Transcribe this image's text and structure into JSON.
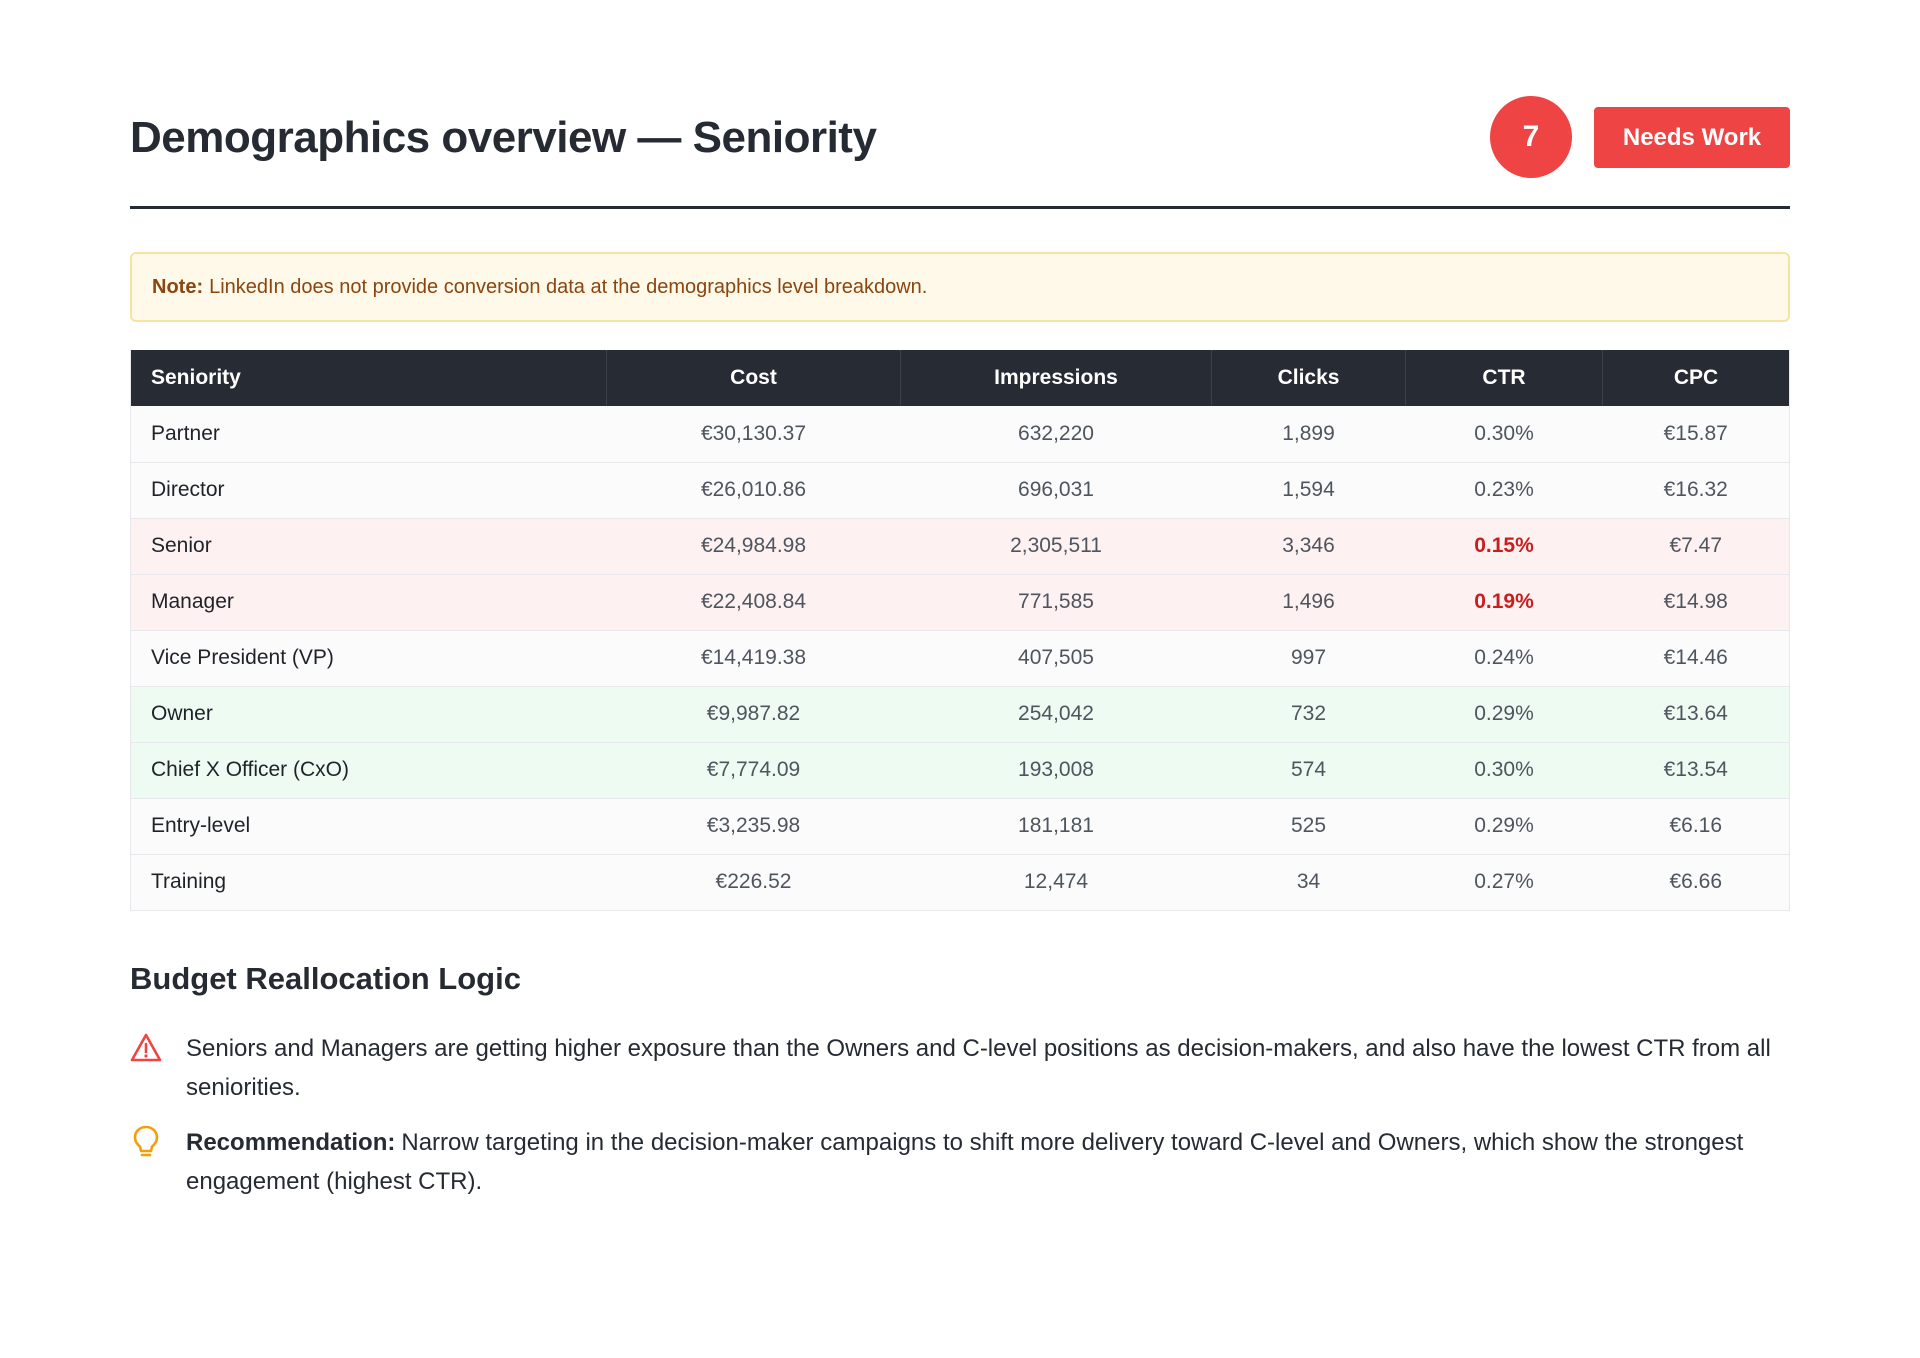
{
  "header": {
    "title": "Demographics overview — Seniority",
    "score": "7",
    "status": "Needs Work"
  },
  "note": {
    "label": "Note:",
    "text": "LinkedIn does not provide conversion data at the demographics level breakdown."
  },
  "table": {
    "columns": [
      "Seniority",
      "Cost",
      "Impressions",
      "Clicks",
      "CTR",
      "CPC"
    ],
    "rows": [
      {
        "name": "Partner",
        "cost": "€30,130.37",
        "impressions": "632,220",
        "clicks": "1,899",
        "ctr": "0.30%",
        "cpc": "€15.87",
        "highlight": "none"
      },
      {
        "name": "Director",
        "cost": "€26,010.86",
        "impressions": "696,031",
        "clicks": "1,594",
        "ctr": "0.23%",
        "cpc": "€16.32",
        "highlight": "none"
      },
      {
        "name": "Senior",
        "cost": "€24,984.98",
        "impressions": "2,305,511",
        "clicks": "3,346",
        "ctr": "0.15%",
        "cpc": "€7.47",
        "highlight": "negative"
      },
      {
        "name": "Manager",
        "cost": "€22,408.84",
        "impressions": "771,585",
        "clicks": "1,496",
        "ctr": "0.19%",
        "cpc": "€14.98",
        "highlight": "negative"
      },
      {
        "name": "Vice President (VP)",
        "cost": "€14,419.38",
        "impressions": "407,505",
        "clicks": "997",
        "ctr": "0.24%",
        "cpc": "€14.46",
        "highlight": "none"
      },
      {
        "name": "Owner",
        "cost": "€9,987.82",
        "impressions": "254,042",
        "clicks": "732",
        "ctr": "0.29%",
        "cpc": "€13.64",
        "highlight": "positive"
      },
      {
        "name": "Chief X Officer (CxO)",
        "cost": "€7,774.09",
        "impressions": "193,008",
        "clicks": "574",
        "ctr": "0.30%",
        "cpc": "€13.54",
        "highlight": "positive"
      },
      {
        "name": "Entry-level",
        "cost": "€3,235.98",
        "impressions": "181,181",
        "clicks": "525",
        "ctr": "0.29%",
        "cpc": "€6.16",
        "highlight": "none"
      },
      {
        "name": "Training",
        "cost": "€226.52",
        "impressions": "12,474",
        "clicks": "34",
        "ctr": "0.27%",
        "cpc": "€6.66",
        "highlight": "none"
      }
    ]
  },
  "section": {
    "title": "Budget Reallocation Logic",
    "bullets": [
      {
        "icon": "warning-triangle-icon",
        "strong": "",
        "text": "Seniors and Managers are getting higher exposure than the Owners and C-level positions as decision-makers, and also have the lowest CTR from all seniorities."
      },
      {
        "icon": "lightbulb-icon",
        "strong": "Recommendation:",
        "text": "Narrow targeting in the decision-maker campaigns to shift more delivery toward C-level and Owners, which show the strongest engagement (highest CTR)."
      }
    ]
  },
  "colors": {
    "danger": "#ef4444",
    "dark": "#272b33",
    "note_bg": "#fef9e8",
    "note_text": "#8a4510",
    "negative_row": "#fef1f1",
    "positive_row": "#eefbf3",
    "alert_text": "#c81e1e",
    "bulb": "#f59e0b"
  }
}
